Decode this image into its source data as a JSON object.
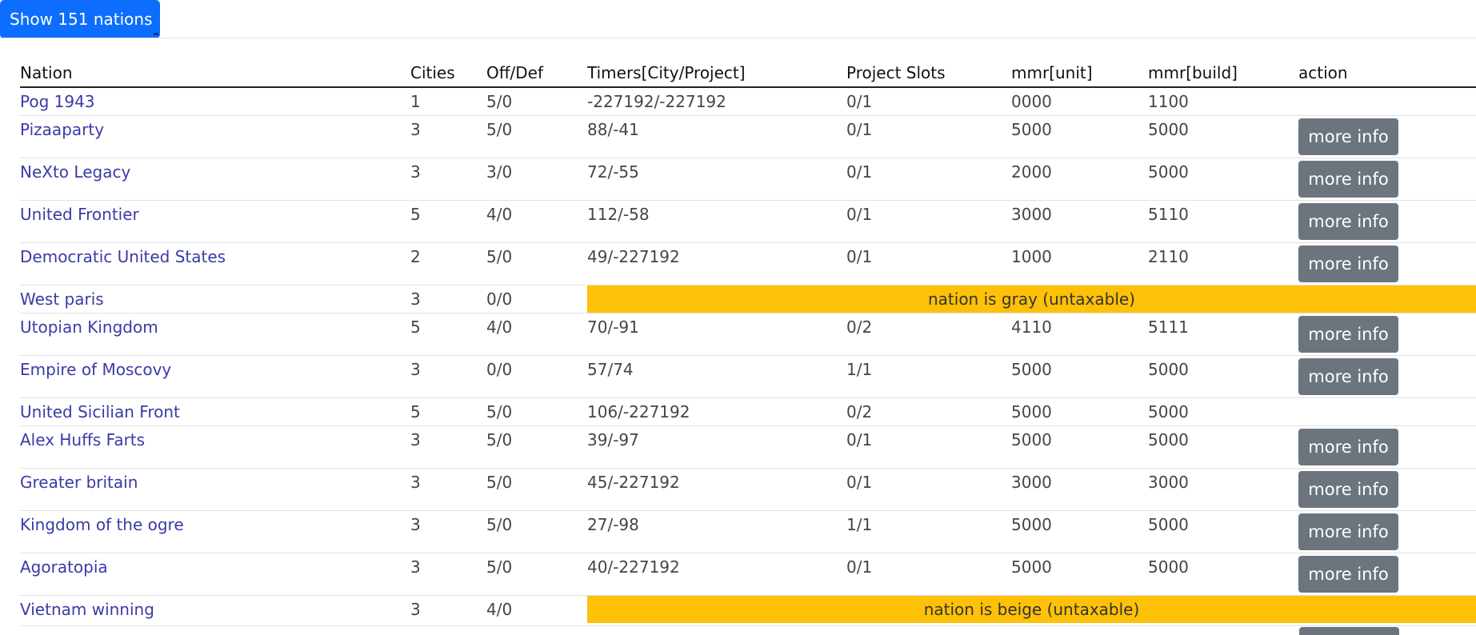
{
  "show_button": {
    "label": "Show 151 nations"
  },
  "table": {
    "headers": [
      "Nation",
      "Cities",
      "Off/Def",
      "Timers[City/Project]",
      "Project Slots",
      "mmr[unit]",
      "mmr[build]",
      "action"
    ],
    "more_info_label": "more info",
    "rows": [
      {
        "nation": "Pog 1943",
        "cities": "1",
        "offdef": "5/0",
        "timers": "-227192/-227192",
        "slots": "0/1",
        "mmr_unit": "0000",
        "mmr_build": "1100",
        "action": ""
      },
      {
        "nation": "Pizaaparty",
        "cities": "3",
        "offdef": "5/0",
        "timers": "88/-41",
        "slots": "0/1",
        "mmr_unit": "5000",
        "mmr_build": "5000",
        "action": "more info"
      },
      {
        "nation": "NeXto Legacy",
        "cities": "3",
        "offdef": "3/0",
        "timers": "72/-55",
        "slots": "0/1",
        "mmr_unit": "2000",
        "mmr_build": "5000",
        "action": "more info"
      },
      {
        "nation": "United Frontier",
        "cities": "5",
        "offdef": "4/0",
        "timers": "112/-58",
        "slots": "0/1",
        "mmr_unit": "3000",
        "mmr_build": "5110",
        "action": "more info"
      },
      {
        "nation": "Democratic United States",
        "cities": "2",
        "offdef": "5/0",
        "timers": "49/-227192",
        "slots": "0/1",
        "mmr_unit": "1000",
        "mmr_build": "2110",
        "action": "more info"
      },
      {
        "nation": "West paris",
        "cities": "3",
        "offdef": "0/0",
        "status": "nation is gray (untaxable)"
      },
      {
        "nation": "Utopian Kingdom",
        "cities": "5",
        "offdef": "4/0",
        "timers": "70/-91",
        "slots": "0/2",
        "mmr_unit": "4110",
        "mmr_build": "5111",
        "action": "more info"
      },
      {
        "nation": "Empire of Moscovy",
        "cities": "3",
        "offdef": "0/0",
        "timers": "57/74",
        "slots": "1/1",
        "mmr_unit": "5000",
        "mmr_build": "5000",
        "action": "more info"
      },
      {
        "nation": "United Sicilian Front",
        "cities": "5",
        "offdef": "5/0",
        "timers": "106/-227192",
        "slots": "0/2",
        "mmr_unit": "5000",
        "mmr_build": "5000",
        "action": ""
      },
      {
        "nation": "Alex Huffs Farts",
        "cities": "3",
        "offdef": "5/0",
        "timers": "39/-97",
        "slots": "0/1",
        "mmr_unit": "5000",
        "mmr_build": "5000",
        "action": "more info"
      },
      {
        "nation": "Greater britain",
        "cities": "3",
        "offdef": "5/0",
        "timers": "45/-227192",
        "slots": "0/1",
        "mmr_unit": "3000",
        "mmr_build": "3000",
        "action": "more info"
      },
      {
        "nation": "Kingdom of the ogre",
        "cities": "3",
        "offdef": "5/0",
        "timers": "27/-98",
        "slots": "1/1",
        "mmr_unit": "5000",
        "mmr_build": "5000",
        "action": "more info"
      },
      {
        "nation": "Agoratopia",
        "cities": "3",
        "offdef": "5/0",
        "timers": "40/-227192",
        "slots": "0/1",
        "mmr_unit": "5000",
        "mmr_build": "5000",
        "action": "more info"
      },
      {
        "nation": "Vietnam winning",
        "cities": "3",
        "offdef": "4/0",
        "status": "nation is beige (untaxable)"
      }
    ]
  },
  "colors": {
    "primary": "#0d6efd",
    "secondary": "#6c757d",
    "warning": "#ffc107",
    "link": "#3a3aa8"
  }
}
